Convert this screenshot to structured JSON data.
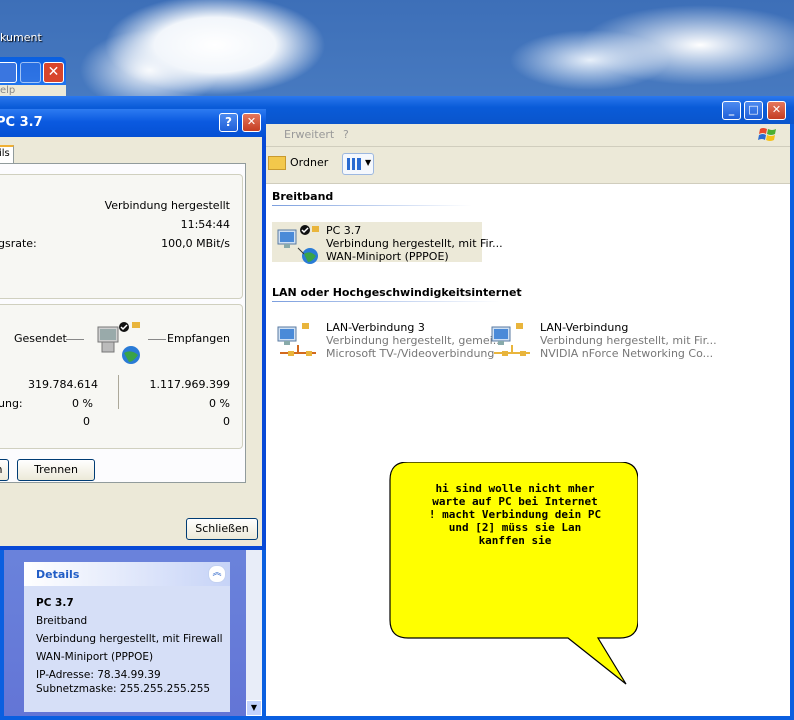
{
  "desktop": {
    "partial_label": "kument"
  },
  "back_window": {
    "menu_partial": "elp"
  },
  "explorer": {
    "menu": {
      "erweitert": "Erweitert",
      "help": "?"
    },
    "toolbar": {
      "folders_label": "Ordner"
    },
    "groups": {
      "breitband": "Breitband",
      "lan": "LAN oder Hochgeschwindigkeitsinternet"
    },
    "connections": {
      "pc37": {
        "name": "PC 3.7",
        "status": "Verbindung hergestellt, mit Fir...",
        "device": "WAN-Miniport (PPPOE)"
      },
      "lan3": {
        "name": "LAN-Verbindung 3",
        "status": "Verbindung hergestellt, gemei...",
        "device": "Microsoft TV-/Videoverbindung"
      },
      "lan": {
        "name": "LAN-Verbindung",
        "status": "Verbindung hergestellt, mit Fir...",
        "device": "NVIDIA nForce Networking Co..."
      }
    },
    "details": {
      "title": "Details",
      "name": "PC 3.7",
      "type": "Breitband",
      "status": "Verbindung hergestellt, mit Firewall",
      "device": "WAN-Miniport (PPPOE)",
      "ip": "IP-Adresse: 78.34.99.39",
      "subnet": "Subnetzmaske: 255.255.255.255"
    }
  },
  "dialog": {
    "title": "PC 3.7",
    "tab_partial": "ils",
    "connection": {
      "status_value": "Verbindung hergestellt",
      "duration_value": "11:54:44",
      "speed_label_partial": "gsrate:",
      "speed_value": "100,0 MBit/s"
    },
    "activity": {
      "sent_label": "Gesendet",
      "received_label": "Empfangen",
      "bytes_sent": "319.784.614",
      "bytes_received": "1.117.969.399",
      "compression_label_partial": "ung:",
      "compression_sent": "0 %",
      "compression_received": "0 %",
      "errors_sent": "0",
      "errors_received": "0"
    },
    "buttons": {
      "disconnect": "Trennen",
      "close": "Schließen",
      "partial": "n"
    }
  },
  "bubble": {
    "text": "hi sind wolle nicht mher\nwarte auf PC bei Internet\n! macht Verbindung dein PC\nund [2] müss sie Lan\nkanffen sie"
  },
  "colors": {
    "titlebar": "#0a55cc",
    "bubble": "#ffff00",
    "details_header": "#215dc6"
  }
}
